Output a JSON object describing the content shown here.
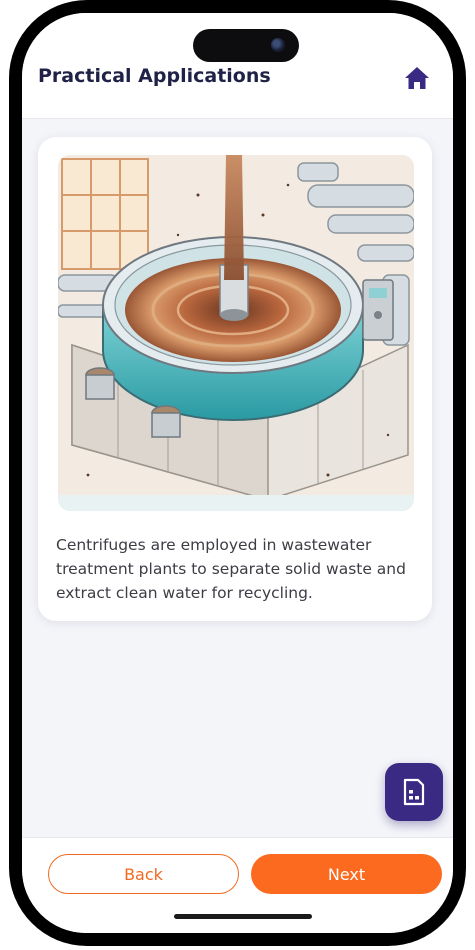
{
  "header": {
    "title": "Practical Applications",
    "home_icon": "home-icon"
  },
  "card": {
    "image_subject": "wastewater-centrifuge-illustration",
    "description": "Centrifuges are employed in wastewater treatment plants to separate solid waste and extract clean water for recycling."
  },
  "fab": {
    "icon": "notes-icon"
  },
  "nav": {
    "back_label": "Back",
    "next_label": "Next"
  },
  "colors": {
    "accent": "#fb6a1e",
    "title": "#1f2147",
    "fab": "#3b2a84"
  }
}
